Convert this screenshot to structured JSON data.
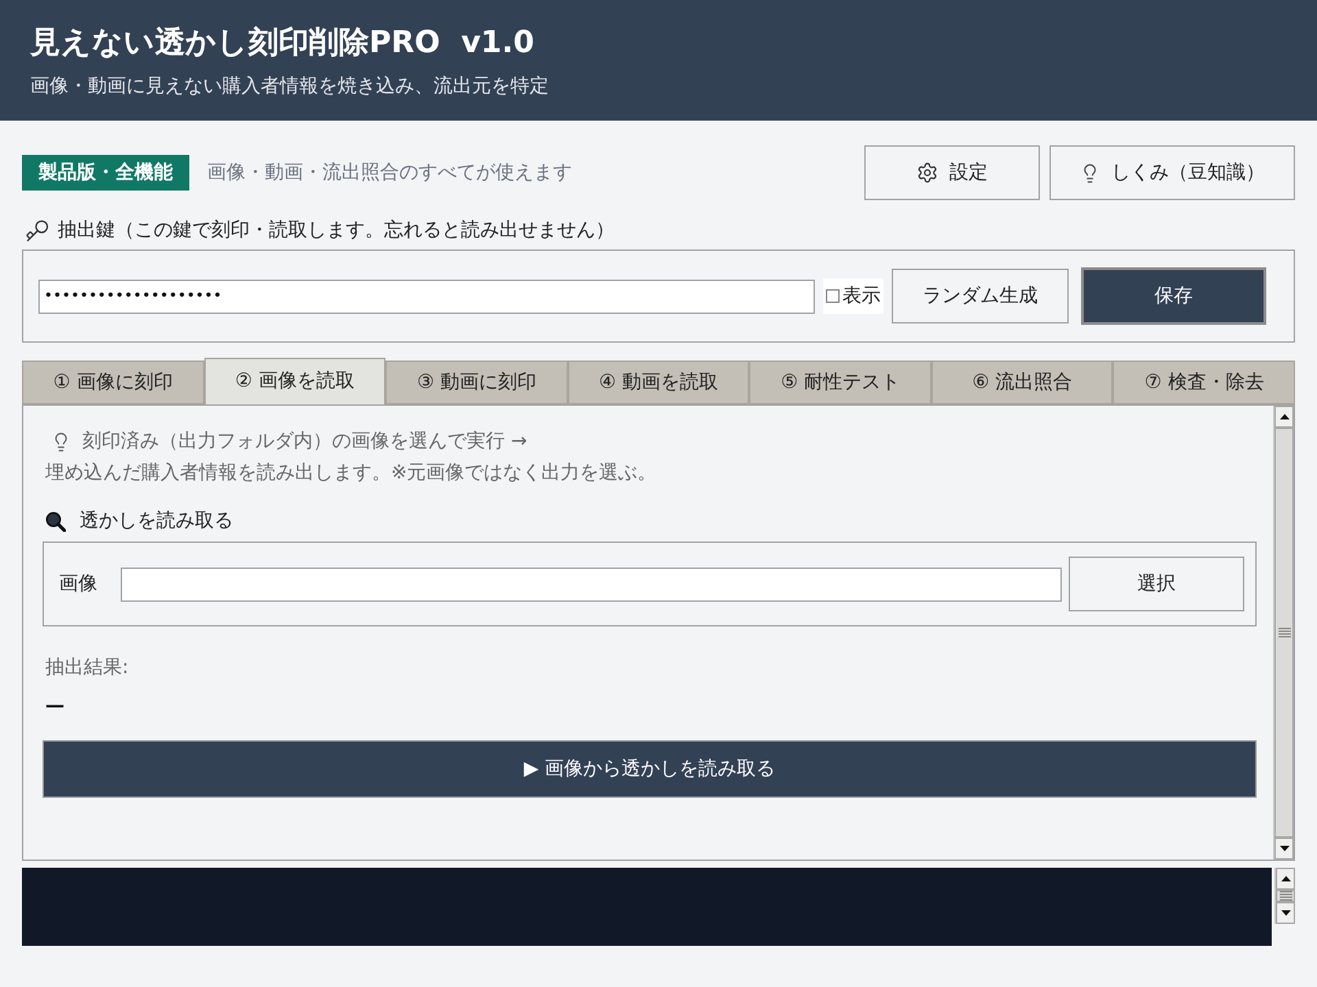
{
  "header": {
    "title": "見えない透かし刻印削除PRO  v1.0",
    "subtitle": "画像・動画に見えない購入者情報を焼き込み、流出元を特定"
  },
  "license": {
    "badge": "製品版・全機能",
    "note": "画像・動画・流出照合のすべてが使えます"
  },
  "top_buttons": [
    {
      "kind": "settings",
      "label": "設定"
    },
    {
      "kind": "tips",
      "label": "しくみ（豆知識）"
    }
  ],
  "key": {
    "label": "抽出鍵（この鍵で刻印・読取します。忘れると読み出せません）",
    "value": "••••••••••••••••••••",
    "show": {
      "label": "表示",
      "checked": false
    },
    "buttons": [
      {
        "label": "ランダム生成",
        "primary": false
      },
      {
        "label": "保存",
        "primary": true
      }
    ]
  },
  "tabs": [
    {
      "label": "① 画像に刻印",
      "selected": false
    },
    {
      "label": "② 画像を読取",
      "selected": true
    },
    {
      "label": "③ 動画に刻印",
      "selected": false
    },
    {
      "label": "④ 動画を読取",
      "selected": false
    },
    {
      "label": "⑤ 耐性テスト",
      "selected": false
    },
    {
      "label": "⑥ 流出照合",
      "selected": false
    },
    {
      "label": "⑦ 検査・除去",
      "selected": false
    }
  ],
  "panel": {
    "hint_lines": [
      "刻印済み（出力フォルダ内）の画像を選んで実行 →",
      "埋め込んだ購入者情報を読み出します。※元画像ではなく出力を選ぶ。"
    ],
    "section_title": "透かしを読み取る",
    "image_field": {
      "label": "画像",
      "button": "選択"
    },
    "result_label": "抽出結果:",
    "result": "—",
    "run_button": "▶ 画像から透かしを読み取る"
  }
}
